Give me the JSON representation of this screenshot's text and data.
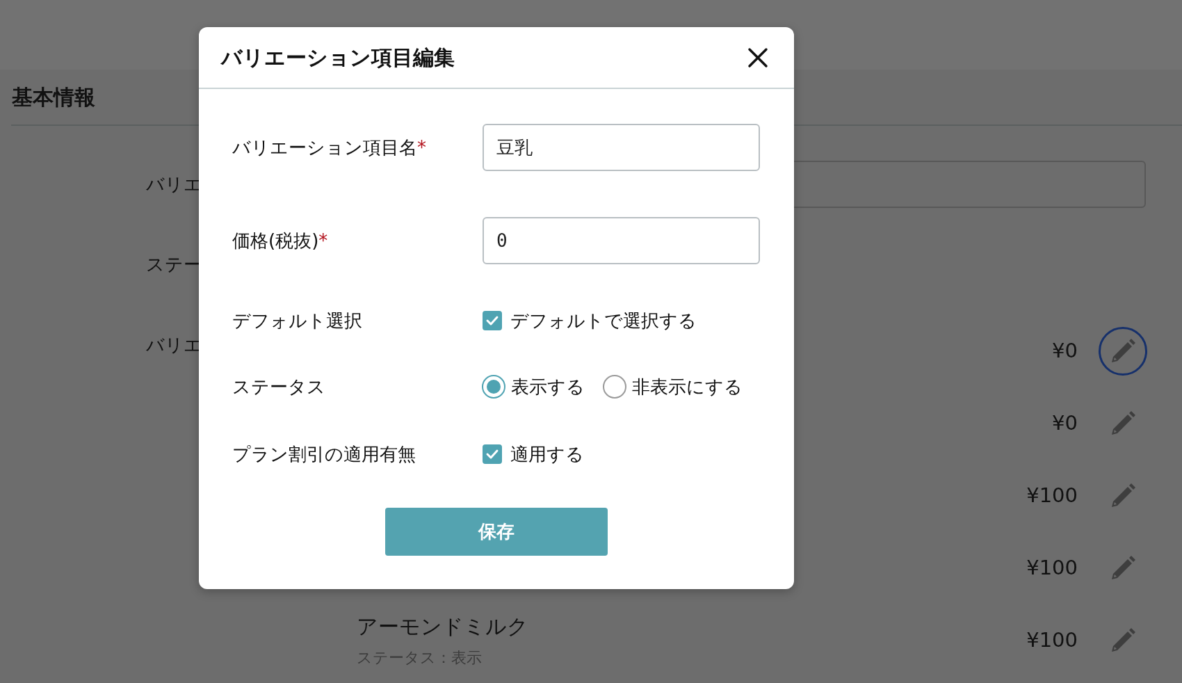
{
  "page": {
    "section_title": "基本情報",
    "form_labels": [
      "バリエ",
      "ステー",
      "バリエ"
    ],
    "variations": [
      {
        "price": "¥0",
        "focused": true
      },
      {
        "price": "¥0",
        "focused": false
      },
      {
        "price": "¥100",
        "focused": false
      },
      {
        "price": "¥100",
        "focused": false
      },
      {
        "name": "アーモンドミルク",
        "status": "ステータス：表示",
        "price": "¥100",
        "focused": false
      }
    ]
  },
  "modal": {
    "title": "バリエーション項目編集",
    "fields": [
      {
        "kind": "text",
        "label": "バリエーション項目名",
        "required_mark": "*",
        "value": "豆乳"
      },
      {
        "kind": "number",
        "label": "価格(税抜)",
        "required_mark": "*",
        "value": "0"
      },
      {
        "kind": "checkbox",
        "label": "デフォルト選択",
        "options": [
          {
            "label": "デフォルトで選択する",
            "checked": true
          }
        ]
      },
      {
        "kind": "radio",
        "label": "ステータス",
        "options": [
          {
            "label": "表示する",
            "selected": true
          },
          {
            "label": "非表示にする",
            "selected": false
          }
        ]
      },
      {
        "kind": "checkbox",
        "label": "プラン割引の適用有無",
        "options": [
          {
            "label": "適用する",
            "checked": true
          }
        ]
      }
    ],
    "save_button": "保存"
  }
}
